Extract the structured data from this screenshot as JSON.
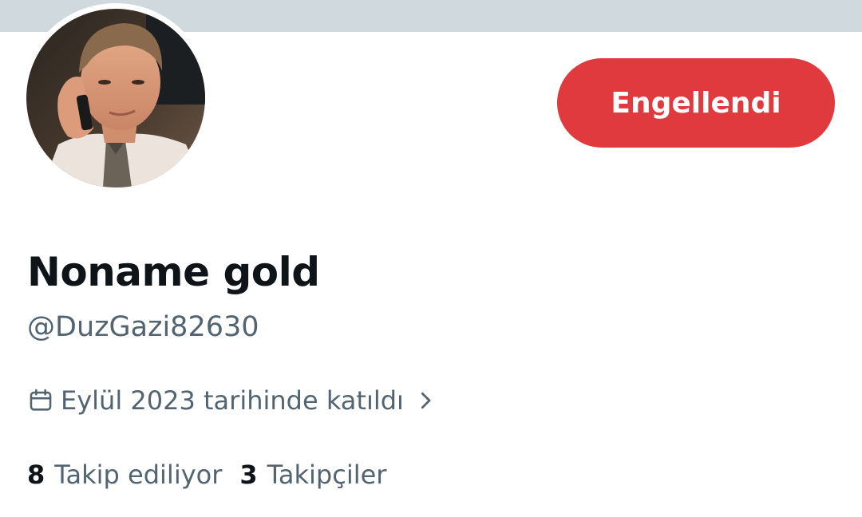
{
  "profile": {
    "avatar_icon": "profile-photo",
    "display_name": "Noname gold",
    "handle": "@DuzGazi82630",
    "joined_text": "Eylül 2023 tarihinde katıldı",
    "joined_icon": "calendar-icon",
    "joined_chevron_icon": "chevron-right-icon"
  },
  "actions": {
    "block_label": "Engellendi"
  },
  "stats": {
    "following_count": "8",
    "following_label": "Takip ediliyor",
    "followers_count": "3",
    "followers_label": "Takipçiler"
  },
  "colors": {
    "banner": "#cfd9de",
    "blocked_button": "#e0393e",
    "primary_text": "#0f1419",
    "secondary_text": "#536471"
  }
}
